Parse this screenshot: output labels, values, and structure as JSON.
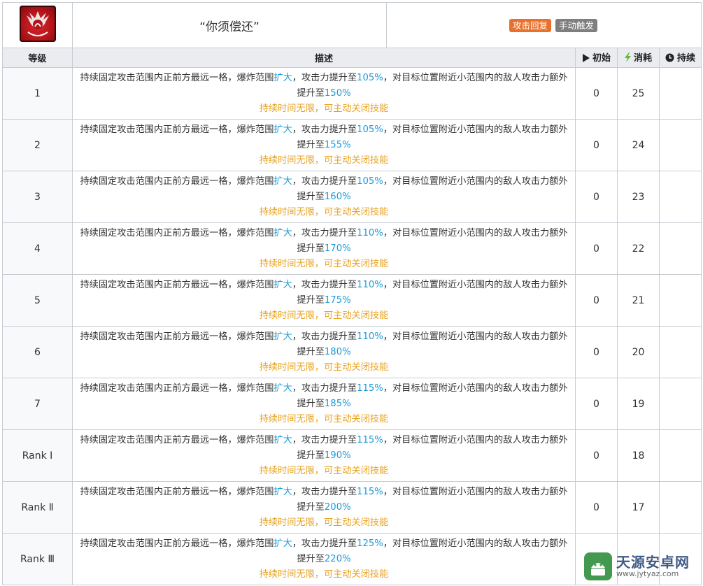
{
  "skill": {
    "name": "“你须偿还”",
    "tags": [
      {
        "label": "攻击回复",
        "color": "#e8722d"
      },
      {
        "label": "手动触发",
        "color": "#7e7e7e"
      }
    ]
  },
  "columns": {
    "level": "等级",
    "description": "描述",
    "initial": "初始",
    "cost": "消耗",
    "duration": "持续"
  },
  "icons": {
    "skill": "skill-emblem-icon",
    "initial": "play-triangle-icon",
    "cost": "lightning-bolt-icon",
    "duration": "clock-icon"
  },
  "rows": [
    {
      "level": "1",
      "p1": "持续固定攻击范围内正前方最远一格，爆炸范围",
      "h1": "扩大",
      "p2": "，攻击力提升至",
      "h2": "105%",
      "p3": "，对目标位置附近小范围内的敌人攻击力额外提升至",
      "h3": "150%",
      "duration_text": "持续时间无限，可主动关闭技能",
      "initial": "0",
      "cost": "25",
      "duration": ""
    },
    {
      "level": "2",
      "p1": "持续固定攻击范围内正前方最远一格，爆炸范围",
      "h1": "扩大",
      "p2": "，攻击力提升至",
      "h2": "105%",
      "p3": "，对目标位置附近小范围内的敌人攻击力额外提升至",
      "h3": "155%",
      "duration_text": "持续时间无限，可主动关闭技能",
      "initial": "0",
      "cost": "24",
      "duration": ""
    },
    {
      "level": "3",
      "p1": "持续固定攻击范围内正前方最远一格，爆炸范围",
      "h1": "扩大",
      "p2": "，攻击力提升至",
      "h2": "105%",
      "p3": "，对目标位置附近小范围内的敌人攻击力额外提升至",
      "h3": "160%",
      "duration_text": "持续时间无限，可主动关闭技能",
      "initial": "0",
      "cost": "23",
      "duration": ""
    },
    {
      "level": "4",
      "p1": "持续固定攻击范围内正前方最远一格，爆炸范围",
      "h1": "扩大",
      "p2": "，攻击力提升至",
      "h2": "110%",
      "p3": "，对目标位置附近小范围内的敌人攻击力额外提升至",
      "h3": "170%",
      "duration_text": "持续时间无限，可主动关闭技能",
      "initial": "0",
      "cost": "22",
      "duration": ""
    },
    {
      "level": "5",
      "p1": "持续固定攻击范围内正前方最远一格，爆炸范围",
      "h1": "扩大",
      "p2": "，攻击力提升至",
      "h2": "110%",
      "p3": "，对目标位置附近小范围内的敌人攻击力额外提升至",
      "h3": "175%",
      "duration_text": "持续时间无限，可主动关闭技能",
      "initial": "0",
      "cost": "21",
      "duration": ""
    },
    {
      "level": "6",
      "p1": "持续固定攻击范围内正前方最远一格，爆炸范围",
      "h1": "扩大",
      "p2": "，攻击力提升至",
      "h2": "110%",
      "p3": "，对目标位置附近小范围内的敌人攻击力额外提升至",
      "h3": "180%",
      "duration_text": "持续时间无限，可主动关闭技能",
      "initial": "0",
      "cost": "20",
      "duration": ""
    },
    {
      "level": "7",
      "p1": "持续固定攻击范围内正前方最远一格，爆炸范围",
      "h1": "扩大",
      "p2": "，攻击力提升至",
      "h2": "115%",
      "p3": "，对目标位置附近小范围内的敌人攻击力额外提升至",
      "h3": "185%",
      "duration_text": "持续时间无限，可主动关闭技能",
      "initial": "0",
      "cost": "19",
      "duration": ""
    },
    {
      "level": "Rank Ⅰ",
      "p1": "持续固定攻击范围内正前方最远一格，爆炸范围",
      "h1": "扩大",
      "p2": "，攻击力提升至",
      "h2": "115%",
      "p3": "，对目标位置附近小范围内的敌人攻击力额外提升至",
      "h3": "190%",
      "duration_text": "持续时间无限，可主动关闭技能",
      "initial": "0",
      "cost": "18",
      "duration": ""
    },
    {
      "level": "Rank Ⅱ",
      "p1": "持续固定攻击范围内正前方最远一格，爆炸范围",
      "h1": "扩大",
      "p2": "，攻击力提升至",
      "h2": "115%",
      "p3": "，对目标位置附近小范围内的敌人攻击力额外提升至",
      "h3": "200%",
      "duration_text": "持续时间无限，可主动关闭技能",
      "initial": "0",
      "cost": "17",
      "duration": ""
    },
    {
      "level": "Rank Ⅲ",
      "p1": "持续固定攻击范围内正前方最远一格，爆炸范围",
      "h1": "扩大",
      "p2": "，攻击力提升至",
      "h2": "125%",
      "p3": "，对目标位置附近小范围内的敌人攻击力额外提升至",
      "h3": "220%",
      "duration_text": "持续时间无限，可主动关闭技能",
      "initial": "",
      "cost": "",
      "duration": ""
    }
  ],
  "watermark": {
    "name": "天源安卓网",
    "url": "www.jytyaz.com"
  }
}
